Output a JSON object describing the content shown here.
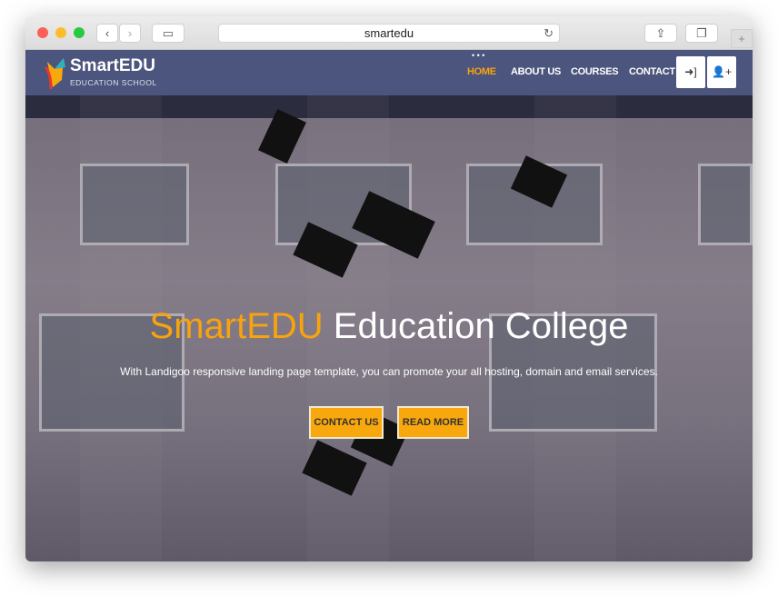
{
  "browser": {
    "url": "smartedu"
  },
  "brand": {
    "name": "SmartEDU",
    "tagline": "EDUCATION SCHOOL"
  },
  "nav": {
    "items": [
      {
        "label": "HOME",
        "active": true
      },
      {
        "label": "ABOUT US"
      },
      {
        "label": "COURSES"
      },
      {
        "label": "CONTACT"
      }
    ],
    "login_icon": "sign-in-icon",
    "register_icon": "user-plus-icon"
  },
  "hero": {
    "title_accent": "SmartEDU",
    "title_rest": " Education College",
    "subtitle": "With Landigoo responsive landing page template, you can promote your all hosting, domain and email services.",
    "buttons": {
      "contact": "CONTACT US",
      "read_more": "READ MORE"
    }
  },
  "colors": {
    "accent": "#f8a70c",
    "nav": "#4b557d"
  }
}
